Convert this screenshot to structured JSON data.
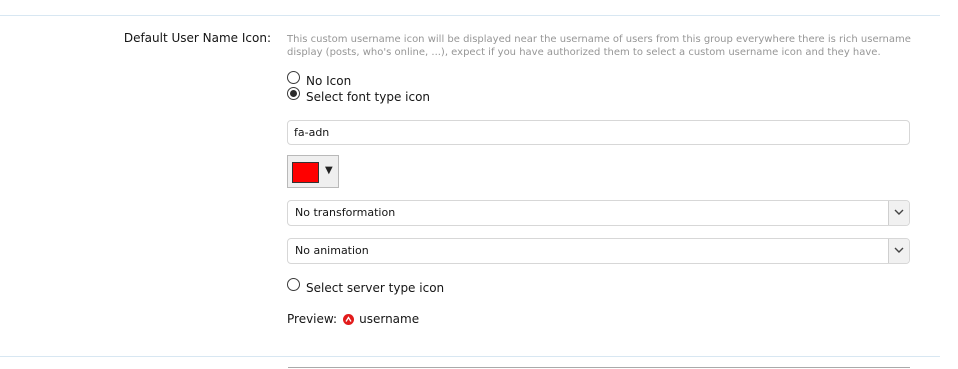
{
  "field": {
    "label": "Default User Name Icon:",
    "explain": "This custom username icon will be displayed near the username of users from this group everywhere there is rich username display (posts, who's online, ...), expect if you have authorized them to select a custom username icon and they have."
  },
  "options": {
    "no_icon": {
      "label": "No Icon",
      "checked": false
    },
    "font_icon": {
      "label": "Select font type icon",
      "checked": true
    },
    "server_icon": {
      "label": "Select server type icon",
      "checked": false
    }
  },
  "icon_name_input": {
    "value": "fa-adn"
  },
  "color_picker": {
    "value": "#ff0000",
    "caret": "▼"
  },
  "transformation_select": {
    "selected": "No transformation",
    "icon": "chevron-down-icon"
  },
  "animation_select": {
    "selected": "No animation",
    "icon": "chevron-down-icon"
  },
  "preview": {
    "label": "Preview:",
    "icon": "adn-icon",
    "icon_color": "#e21b1b",
    "username": "username"
  }
}
